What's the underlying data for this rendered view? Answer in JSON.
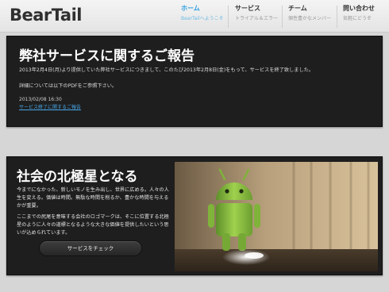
{
  "header": {
    "logo": "BearTail",
    "nav": [
      {
        "title": "ホーム",
        "sub": "BearTailへようこそ",
        "active": true
      },
      {
        "title": "サービス",
        "sub": "トライアル＆エラー",
        "active": false
      },
      {
        "title": "チーム",
        "sub": "個性豊かなメンバー",
        "active": false
      },
      {
        "title": "問い合わせ",
        "sub": "気軽にどうぞ",
        "active": false
      }
    ]
  },
  "notice": {
    "title": "弊社サービスに関するご報告",
    "line1": "2013年2月4日(月)より提供していた弊社サービスにつきまして、このたび2013年2月8日(金)をもって、サービスを終了致しました。",
    "line2": "詳細については以下のPDFをご参照下さい。",
    "date": "2013/02/08 16:30",
    "link": "サービス終了に関するご報告"
  },
  "feature": {
    "title": "社会の北極星となる",
    "paragraph1": "今までになかった、新しいモノを生み出し、世界に広める。人々の人生を変える。価値は時間。無駄な時間を削るか、豊かな時間を与えるかが重要。",
    "paragraph2": "ここまでの尻尾を意味する会社のロゴマークは、そこに位置する北極星のように人々の道標となるような大きな価値を提供したいという思いが込められています。",
    "button": "サービスをチェック"
  },
  "colors": {
    "accent": "#2a9fe0",
    "panel": "#1e1e1e",
    "link": "#47a6e6",
    "android": "#8bc34a"
  }
}
